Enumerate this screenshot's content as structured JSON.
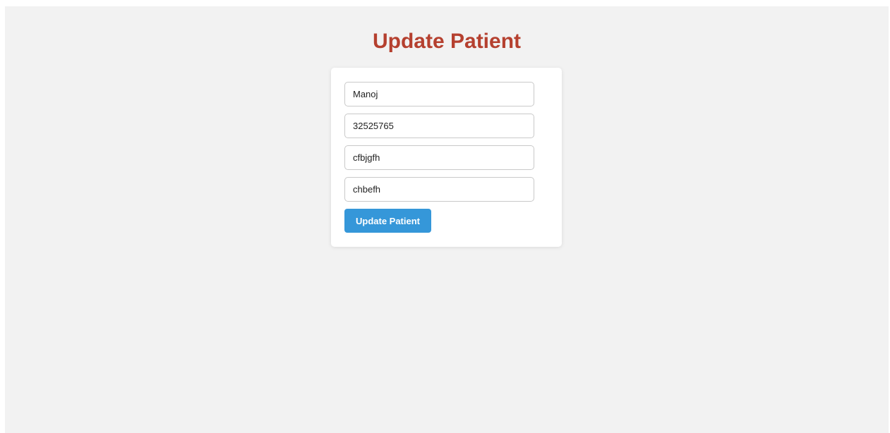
{
  "page": {
    "title": "Update Patient"
  },
  "form": {
    "fields": [
      {
        "value": "Manoj"
      },
      {
        "value": "32525765"
      },
      {
        "value": "cfbjgfh"
      },
      {
        "value": "chbefh"
      }
    ],
    "submit_label": "Update Patient"
  },
  "colors": {
    "title": "#b5402f",
    "button": "#3597d9",
    "background": "#f2f2f2",
    "card": "#ffffff"
  }
}
